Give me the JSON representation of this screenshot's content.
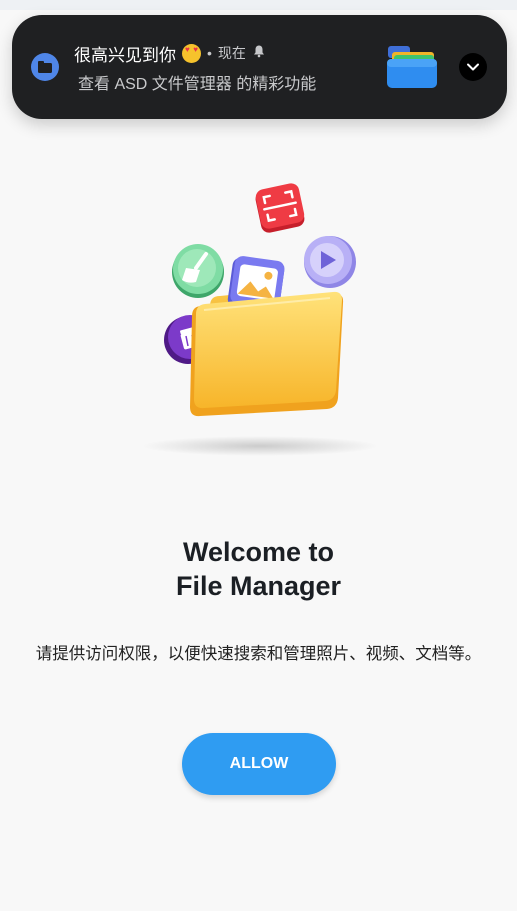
{
  "notification": {
    "title": "很高兴见到你",
    "separator": "•",
    "time": "现在",
    "body": "查看 ASD 文件管理器 的精彩功能",
    "icons": {
      "app": "folder-app-icon",
      "emoji": "heart-eyes-emoji-icon",
      "alert": "bell-icon",
      "thumbnail": "folder-thumbnail-icon",
      "expand": "chevron-down-icon"
    }
  },
  "main": {
    "illustration_icons": [
      "scan-icon",
      "broom-icon",
      "image-icon",
      "play-icon",
      "trash-icon",
      "folder-icon"
    ],
    "welcome_line1": "Welcome to",
    "welcome_line2": "File Manager",
    "description": "请提供访问权限，以便快速搜索和管理照片、视频、文档等。",
    "allow_label": "ALLOW"
  },
  "colors": {
    "accent": "#2f9cf2",
    "notification_bg": "#1f2022",
    "background": "#f8f8f8"
  }
}
